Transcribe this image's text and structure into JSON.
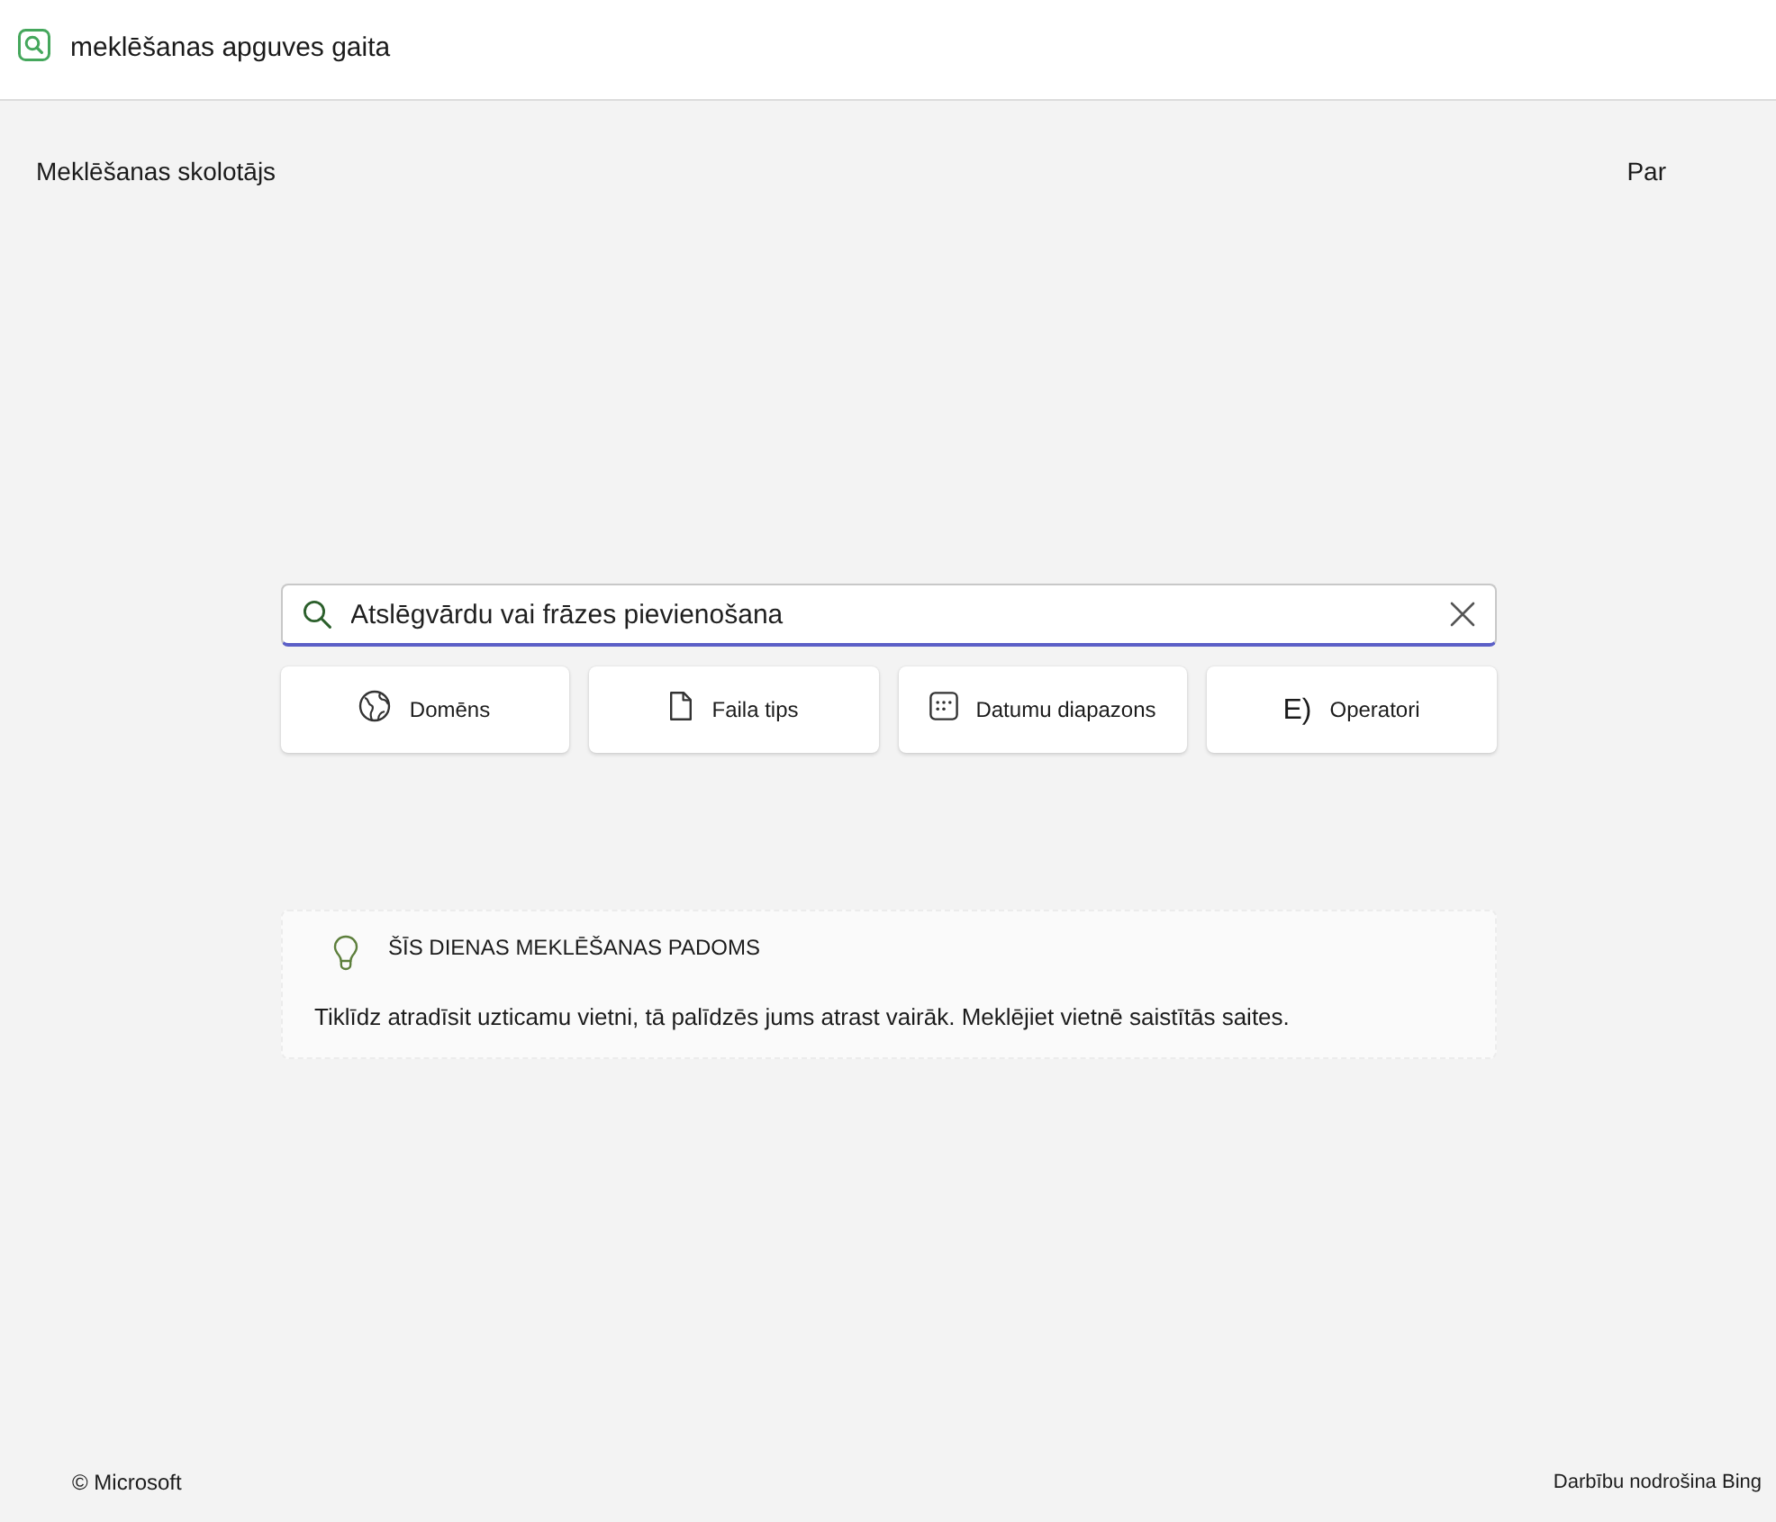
{
  "header": {
    "title": "meklēšanas apguves gaita"
  },
  "nav": {
    "title": "Meklēšanas skolotājs",
    "about_link": "Par"
  },
  "search": {
    "placeholder": "Atslēgvārdu vai frāzes pievienošana"
  },
  "filters": [
    {
      "kind": "globe",
      "label": "Domēns"
    },
    {
      "kind": "file",
      "label": "Faila tips"
    },
    {
      "kind": "calendar",
      "label": "Datumu diapazons"
    },
    {
      "kind": "glyph",
      "glyph": "E)",
      "label": "Operatori"
    }
  ],
  "tip": {
    "heading": "ŠĪS DIENAS MEKLĒŠANAS PADOMS",
    "text": "Tiklīdz atradīsit uzticamu vietni, tā palīdzēs jums atrast vairāk. Meklējiet vietnē saistītās saites."
  },
  "footer": {
    "copyright": "© Microsoft",
    "powered_by": "Darbību nodrošina Bing"
  }
}
